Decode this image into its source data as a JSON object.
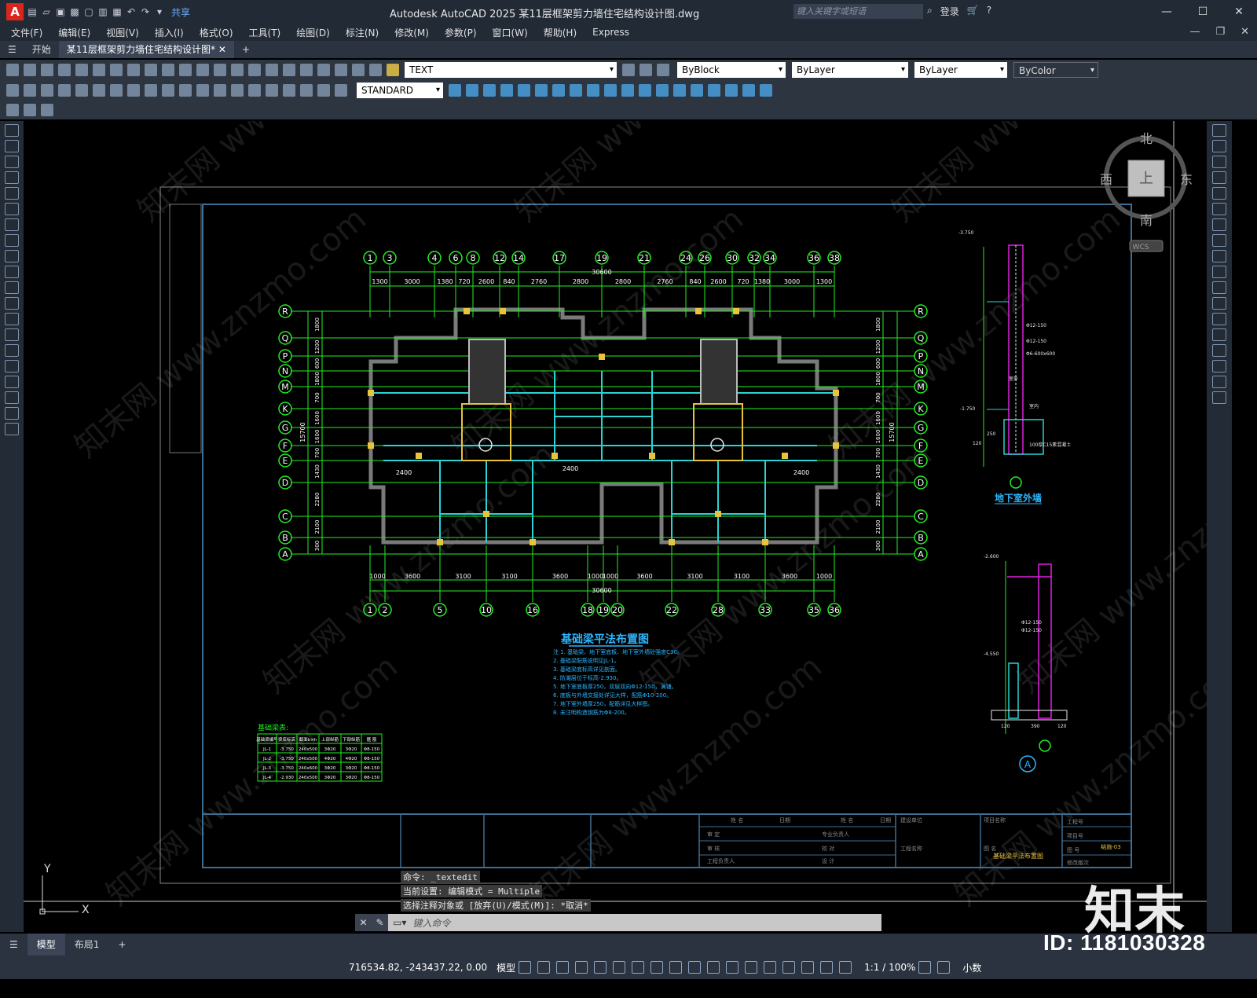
{
  "app": {
    "window_title": "Autodesk AutoCAD 2025    某11层框架剪力墙住宅结构设计图.dwg",
    "share_label": "共享",
    "search_placeholder": "键入关键字或短语",
    "login_label": "登录"
  },
  "menu": [
    "文件(F)",
    "编辑(E)",
    "视图(V)",
    "插入(I)",
    "格式(O)",
    "工具(T)",
    "绘图(D)",
    "标注(N)",
    "修改(M)",
    "参数(P)",
    "窗口(W)",
    "帮助(H)",
    "Express"
  ],
  "tabs": [
    {
      "label": "开始"
    },
    {
      "label": "某11层框架剪力墙住宅结构设计图*"
    }
  ],
  "toolbar": {
    "layer_name": "TEXT",
    "color": "ByBlock",
    "linetype": "ByLayer",
    "lineweight": "ByLayer",
    "plotstyle": "ByColor",
    "textstyle": "STANDARD"
  },
  "viewcube": {
    "north": "北",
    "south": "南",
    "east": "东",
    "west": "西",
    "top": "上",
    "wcs": "WCS"
  },
  "drawing": {
    "top_axes": [
      "1",
      "3",
      "4",
      "6",
      "8",
      "12",
      "14",
      "17",
      "19",
      "21",
      "24",
      "26",
      "30",
      "32",
      "34",
      "36",
      "38"
    ],
    "top_dims": [
      "1300",
      "3000",
      "1380",
      "720",
      "2600",
      "840",
      "2760",
      "2800",
      "2800",
      "2760",
      "840",
      "2600",
      "720",
      "1380",
      "3000",
      "1300"
    ],
    "top_total": "30600",
    "bottom_axes": [
      "1",
      "2",
      "5",
      "10",
      "16",
      "18",
      "19",
      "20",
      "22",
      "28",
      "33",
      "35",
      "36"
    ],
    "bottom_dims": [
      "1000",
      "3600",
      "3100",
      "3100",
      "3600",
      "1000",
      "1000",
      "3600",
      "3100",
      "3100",
      "3600",
      "1000"
    ],
    "bottom_total": "30600",
    "row_axes": [
      "R",
      "Q",
      "P",
      "N",
      "M",
      "K",
      "G",
      "F",
      "E",
      "D",
      "C",
      "B",
      "A"
    ],
    "left_total": "15700",
    "right_total": "15700",
    "left_dims": [
      "1800",
      "1200",
      "600",
      "1800",
      "700",
      "1600",
      "1600",
      "700",
      "1430",
      "2280",
      "2100",
      "300"
    ],
    "dim_2400": "2400",
    "plan_title": "基础梁平法布置图",
    "notes": [
      "注 1. 基础梁、地下室底板、地下室外墙砼强度C30。",
      "2. 基础梁配筋说明见JL-1。",
      "3. 基础梁底标高详见剖面。",
      "4. 防潮层位于标高-2.930。",
      "5. 地下室底板厚250，双层双向Φ12-150，满铺。",
      "6. 底板与外墙交接处详见大样，配筋Φ10-200。",
      "7. 地下室外墙厚250，配筋详见大样图。",
      "8. 未注明构造钢筋为Φ8-200。"
    ],
    "beam_table_title": "基础梁表:",
    "beam_table_header": [
      "基础梁编号",
      "梁底标高",
      "截面b×h",
      "上部纵筋",
      "下部纵筋",
      "箍 筋"
    ],
    "beam_table_rows": [
      [
        "JL-1",
        "-3.750",
        "240x500",
        "3Φ20",
        "3Φ20",
        "Φ8-150"
      ],
      [
        "JL-2",
        "-3.750",
        "240x500",
        "4Φ20",
        "4Φ20",
        "Φ8-150"
      ],
      [
        "JL-3",
        "-3.750",
        "240x600",
        "3Φ20",
        "3Φ20",
        "Φ8-150"
      ],
      [
        "JL-4",
        "-2.930",
        "240x500",
        "3Φ20",
        "3Φ20",
        "Φ8-150"
      ]
    ],
    "section1_title": "地下室外墙",
    "section1_labels": [
      "Φ12-150",
      "Φ12-150",
      "Φ6-600x600",
      "室外",
      "室内",
      "100厚C15素混凝土",
      "-1.750",
      "120",
      "-3.750",
      "250"
    ],
    "section2_axis": "A",
    "section2_labels": [
      "-2.600",
      "Φ12-150",
      "Φ12-150",
      "-4.550",
      "120",
      "390",
      "120"
    ],
    "titleblock": {
      "drawing_name": "基础梁平法布置图",
      "drawing_no": "结施-03",
      "cells": [
        "姓 名",
        "日期",
        "姓 名",
        "日期",
        "审 定",
        "专业负责人",
        "审 核",
        "校 对",
        "工程负责人",
        "设 计",
        "建设单位",
        "工程名称",
        "项目名称",
        "图 名",
        "工程号",
        "项目号",
        "图 号",
        "修改版次"
      ]
    }
  },
  "command_history": [
    "命令: _textedit",
    "当前设置: 编辑模式 = Multiple",
    "选择注释对象或 [放弃(U)/模式(M)]: *取消*"
  ],
  "command_placeholder": "键入命令",
  "layout_tabs": [
    {
      "label": "模型"
    },
    {
      "label": "布局1"
    }
  ],
  "status": {
    "coords": "716534.82, -243437.22, 0.00",
    "space": "模型",
    "scale": "1:1 / 100%",
    "units": "小数"
  },
  "watermark": {
    "logo": "知末",
    "id": "ID: 1181030328",
    "url": "www.znzmo.com",
    "site": "知末网"
  }
}
